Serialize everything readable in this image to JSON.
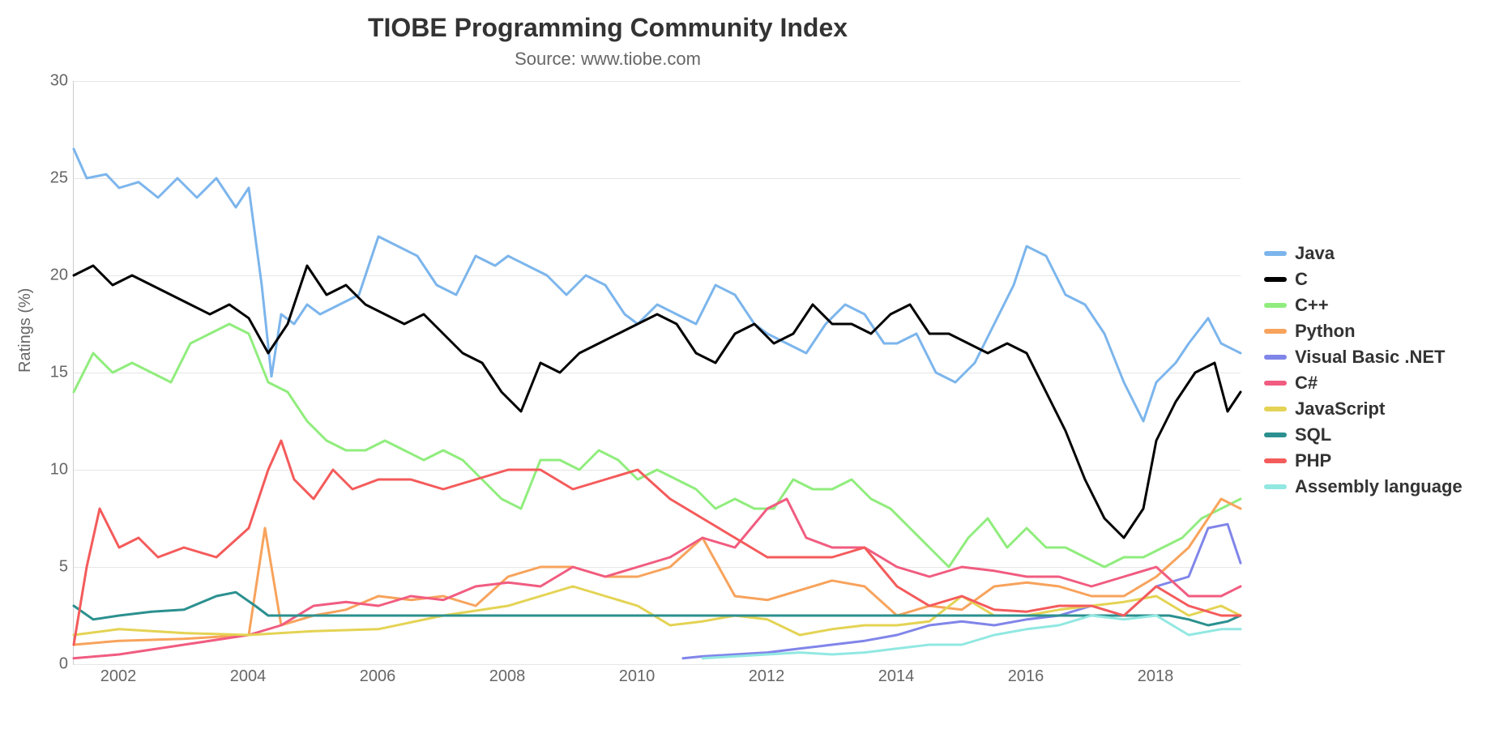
{
  "chart_data": {
    "type": "line",
    "title": "TIOBE Programming Community Index",
    "subtitle": "Source: www.tiobe.com",
    "ylabel": "Ratings (%)",
    "xlabel": "",
    "ylim": [
      0,
      30
    ],
    "xlim": [
      2001.3,
      2019.3
    ],
    "xticks": [
      2002,
      2004,
      2006,
      2008,
      2010,
      2012,
      2014,
      2016,
      2018
    ],
    "yticks": [
      0,
      5,
      10,
      15,
      20,
      25,
      30
    ],
    "grid": true,
    "legend_position": "right",
    "series": [
      {
        "name": "Java",
        "color": "#7cb5ec",
        "x": [
          2001.3,
          2001.5,
          2001.8,
          2002.0,
          2002.3,
          2002.6,
          2002.9,
          2003.2,
          2003.5,
          2003.8,
          2004.0,
          2004.2,
          2004.35,
          2004.5,
          2004.7,
          2004.9,
          2005.1,
          2005.4,
          2005.7,
          2006.0,
          2006.3,
          2006.6,
          2006.9,
          2007.2,
          2007.5,
          2007.8,
          2008.0,
          2008.3,
          2008.6,
          2008.9,
          2009.2,
          2009.5,
          2009.8,
          2010.0,
          2010.3,
          2010.6,
          2010.9,
          2011.2,
          2011.5,
          2011.8,
          2012.0,
          2012.3,
          2012.6,
          2012.9,
          2013.2,
          2013.5,
          2013.8,
          2014.0,
          2014.3,
          2014.6,
          2014.9,
          2015.2,
          2015.5,
          2015.8,
          2016.0,
          2016.3,
          2016.6,
          2016.9,
          2017.2,
          2017.5,
          2017.8,
          2018.0,
          2018.3,
          2018.5,
          2018.8,
          2019.0,
          2019.3
        ],
        "y": [
          26.5,
          25.0,
          25.2,
          24.5,
          24.8,
          24.0,
          25.0,
          24.0,
          25.0,
          23.5,
          24.5,
          19.5,
          14.8,
          18.0,
          17.5,
          18.5,
          18.0,
          18.5,
          19.0,
          22.0,
          21.5,
          21.0,
          19.5,
          19.0,
          21.0,
          20.5,
          21.0,
          20.5,
          20.0,
          19.0,
          20.0,
          19.5,
          18.0,
          17.5,
          18.5,
          18.0,
          17.5,
          19.5,
          19.0,
          17.5,
          17.0,
          16.5,
          16.0,
          17.5,
          18.5,
          18.0,
          16.5,
          16.5,
          17.0,
          15.0,
          14.5,
          15.5,
          17.5,
          19.5,
          21.5,
          21.0,
          19.0,
          18.5,
          17.0,
          14.5,
          12.5,
          14.5,
          15.5,
          16.5,
          17.8,
          16.5,
          16.0
        ]
      },
      {
        "name": "C",
        "color": "#000000",
        "x": [
          2001.3,
          2001.6,
          2001.9,
          2002.2,
          2002.5,
          2002.8,
          2003.1,
          2003.4,
          2003.7,
          2004.0,
          2004.3,
          2004.6,
          2004.9,
          2005.2,
          2005.5,
          2005.8,
          2006.1,
          2006.4,
          2006.7,
          2007.0,
          2007.3,
          2007.6,
          2007.9,
          2008.2,
          2008.5,
          2008.8,
          2009.1,
          2009.4,
          2009.7,
          2010.0,
          2010.3,
          2010.6,
          2010.9,
          2011.2,
          2011.5,
          2011.8,
          2012.1,
          2012.4,
          2012.7,
          2013.0,
          2013.3,
          2013.6,
          2013.9,
          2014.2,
          2014.5,
          2014.8,
          2015.1,
          2015.4,
          2015.7,
          2016.0,
          2016.3,
          2016.6,
          2016.9,
          2017.2,
          2017.5,
          2017.8,
          2018.0,
          2018.3,
          2018.6,
          2018.9,
          2019.1,
          2019.3
        ],
        "y": [
          20.0,
          20.5,
          19.5,
          20.0,
          19.5,
          19.0,
          18.5,
          18.0,
          18.5,
          17.8,
          16.0,
          17.5,
          20.5,
          19.0,
          19.5,
          18.5,
          18.0,
          17.5,
          18.0,
          17.0,
          16.0,
          15.5,
          14.0,
          13.0,
          15.5,
          15.0,
          16.0,
          16.5,
          17.0,
          17.5,
          18.0,
          17.5,
          16.0,
          15.5,
          17.0,
          17.5,
          16.5,
          17.0,
          18.5,
          17.5,
          17.5,
          17.0,
          18.0,
          18.5,
          17.0,
          17.0,
          16.5,
          16.0,
          16.5,
          16.0,
          14.0,
          12.0,
          9.5,
          7.5,
          6.5,
          8.0,
          11.5,
          13.5,
          15.0,
          15.5,
          13.0,
          14.0
        ]
      },
      {
        "name": "C++",
        "color": "#90ed7d",
        "x": [
          2001.3,
          2001.6,
          2001.9,
          2002.2,
          2002.5,
          2002.8,
          2003.1,
          2003.4,
          2003.7,
          2004.0,
          2004.3,
          2004.6,
          2004.9,
          2005.2,
          2005.5,
          2005.8,
          2006.1,
          2006.4,
          2006.7,
          2007.0,
          2007.3,
          2007.6,
          2007.9,
          2008.2,
          2008.5,
          2008.8,
          2009.1,
          2009.4,
          2009.7,
          2010.0,
          2010.3,
          2010.6,
          2010.9,
          2011.2,
          2011.5,
          2011.8,
          2012.1,
          2012.4,
          2012.7,
          2013.0,
          2013.3,
          2013.6,
          2013.9,
          2014.2,
          2014.5,
          2014.8,
          2015.1,
          2015.4,
          2015.7,
          2016.0,
          2016.3,
          2016.6,
          2016.9,
          2017.2,
          2017.5,
          2017.8,
          2018.1,
          2018.4,
          2018.7,
          2019.0,
          2019.3
        ],
        "y": [
          14.0,
          16.0,
          15.0,
          15.5,
          15.0,
          14.5,
          16.5,
          17.0,
          17.5,
          17.0,
          14.5,
          14.0,
          12.5,
          11.5,
          11.0,
          11.0,
          11.5,
          11.0,
          10.5,
          11.0,
          10.5,
          9.5,
          8.5,
          8.0,
          10.5,
          10.5,
          10.0,
          11.0,
          10.5,
          9.5,
          10.0,
          9.5,
          9.0,
          8.0,
          8.5,
          8.0,
          8.0,
          9.5,
          9.0,
          9.0,
          9.5,
          8.5,
          8.0,
          7.0,
          6.0,
          5.0,
          6.5,
          7.5,
          6.0,
          7.0,
          6.0,
          6.0,
          5.5,
          5.0,
          5.5,
          5.5,
          6.0,
          6.5,
          7.5,
          8.0,
          8.5
        ]
      },
      {
        "name": "Python",
        "color": "#f7a35c",
        "x": [
          2001.3,
          2002.0,
          2003.0,
          2004.0,
          2004.25,
          2004.5,
          2005.0,
          2005.5,
          2006.0,
          2006.5,
          2007.0,
          2007.5,
          2008.0,
          2008.5,
          2009.0,
          2009.5,
          2010.0,
          2010.5,
          2011.0,
          2011.5,
          2012.0,
          2012.5,
          2013.0,
          2013.5,
          2014.0,
          2014.5,
          2015.0,
          2015.5,
          2016.0,
          2016.5,
          2017.0,
          2017.5,
          2018.0,
          2018.5,
          2019.0,
          2019.3
        ],
        "y": [
          1.0,
          1.2,
          1.3,
          1.5,
          7.0,
          2.0,
          2.5,
          2.8,
          3.5,
          3.3,
          3.5,
          3.0,
          4.5,
          5.0,
          5.0,
          4.5,
          4.5,
          5.0,
          6.5,
          3.5,
          3.3,
          3.8,
          4.3,
          4.0,
          2.5,
          3.0,
          2.8,
          4.0,
          4.2,
          4.0,
          3.5,
          3.5,
          4.5,
          6.0,
          8.5,
          8.0
        ]
      },
      {
        "name": "Visual Basic .NET",
        "color": "#8085e9",
        "x": [
          2010.7,
          2011.0,
          2011.5,
          2012.0,
          2012.5,
          2013.0,
          2013.5,
          2014.0,
          2014.5,
          2015.0,
          2015.5,
          2016.0,
          2016.5,
          2017.0,
          2017.5,
          2018.0,
          2018.5,
          2018.8,
          2019.1,
          2019.3
        ],
        "y": [
          0.3,
          0.4,
          0.5,
          0.6,
          0.8,
          1.0,
          1.2,
          1.5,
          2.0,
          2.2,
          2.0,
          2.3,
          2.5,
          3.0,
          2.5,
          4.0,
          4.5,
          7.0,
          7.2,
          5.2
        ]
      },
      {
        "name": "C#",
        "color": "#f15c80",
        "x": [
          2001.3,
          2002.0,
          2003.0,
          2004.0,
          2004.5,
          2005.0,
          2005.5,
          2006.0,
          2006.5,
          2007.0,
          2007.5,
          2008.0,
          2008.5,
          2009.0,
          2009.5,
          2010.0,
          2010.5,
          2011.0,
          2011.5,
          2012.0,
          2012.3,
          2012.6,
          2013.0,
          2013.5,
          2014.0,
          2014.5,
          2015.0,
          2015.5,
          2016.0,
          2016.5,
          2017.0,
          2017.5,
          2018.0,
          2018.5,
          2019.0,
          2019.3
        ],
        "y": [
          0.3,
          0.5,
          1.0,
          1.5,
          2.0,
          3.0,
          3.2,
          3.0,
          3.5,
          3.3,
          4.0,
          4.2,
          4.0,
          5.0,
          4.5,
          5.0,
          5.5,
          6.5,
          6.0,
          8.0,
          8.5,
          6.5,
          6.0,
          6.0,
          5.0,
          4.5,
          5.0,
          4.8,
          4.5,
          4.5,
          4.0,
          4.5,
          5.0,
          3.5,
          3.5,
          4.0
        ]
      },
      {
        "name": "JavaScript",
        "color": "#e4d354",
        "x": [
          2001.3,
          2002.0,
          2003.0,
          2004.0,
          2005.0,
          2006.0,
          2007.0,
          2008.0,
          2008.5,
          2009.0,
          2009.5,
          2010.0,
          2010.5,
          2011.0,
          2011.5,
          2012.0,
          2012.5,
          2013.0,
          2013.5,
          2014.0,
          2014.5,
          2015.0,
          2015.5,
          2016.0,
          2016.5,
          2017.0,
          2017.5,
          2018.0,
          2018.5,
          2019.0,
          2019.3
        ],
        "y": [
          1.5,
          1.8,
          1.6,
          1.5,
          1.7,
          1.8,
          2.5,
          3.0,
          3.5,
          4.0,
          3.5,
          3.0,
          2.0,
          2.2,
          2.5,
          2.3,
          1.5,
          1.8,
          2.0,
          2.0,
          2.2,
          3.5,
          2.5,
          2.5,
          2.8,
          3.0,
          3.2,
          3.5,
          2.5,
          3.0,
          2.5
        ]
      },
      {
        "name": "SQL",
        "color": "#2b908f",
        "x": [
          2001.3,
          2001.6,
          2002.0,
          2002.5,
          2003.0,
          2003.5,
          2003.8,
          2004.1,
          2004.3,
          2018.2,
          2018.5,
          2018.8,
          2019.1,
          2019.3
        ],
        "y": [
          3.0,
          2.3,
          2.5,
          2.7,
          2.8,
          3.5,
          3.7,
          3.0,
          2.5,
          2.5,
          2.3,
          2.0,
          2.2,
          2.5
        ]
      },
      {
        "name": "PHP",
        "color": "#f45b5b",
        "x": [
          2001.3,
          2001.5,
          2001.7,
          2002.0,
          2002.3,
          2002.6,
          2003.0,
          2003.5,
          2004.0,
          2004.3,
          2004.5,
          2004.7,
          2005.0,
          2005.3,
          2005.6,
          2006.0,
          2006.5,
          2007.0,
          2007.5,
          2008.0,
          2008.5,
          2009.0,
          2009.5,
          2010.0,
          2010.5,
          2011.0,
          2011.5,
          2012.0,
          2012.5,
          2013.0,
          2013.5,
          2014.0,
          2014.5,
          2015.0,
          2015.5,
          2016.0,
          2016.5,
          2017.0,
          2017.5,
          2018.0,
          2018.5,
          2019.0,
          2019.3
        ],
        "y": [
          1.0,
          5.0,
          8.0,
          6.0,
          6.5,
          5.5,
          6.0,
          5.5,
          7.0,
          10.0,
          11.5,
          9.5,
          8.5,
          10.0,
          9.0,
          9.5,
          9.5,
          9.0,
          9.5,
          10.0,
          10.0,
          9.0,
          9.5,
          10.0,
          8.5,
          7.5,
          6.5,
          5.5,
          5.5,
          5.5,
          6.0,
          4.0,
          3.0,
          3.5,
          2.8,
          2.7,
          3.0,
          3.0,
          2.5,
          4.0,
          3.0,
          2.5,
          2.5
        ]
      },
      {
        "name": "Assembly language",
        "color": "#91e8e1",
        "x": [
          2011.0,
          2011.5,
          2012.0,
          2012.5,
          2013.0,
          2013.5,
          2014.0,
          2014.5,
          2015.0,
          2015.5,
          2016.0,
          2016.5,
          2017.0,
          2017.5,
          2018.0,
          2018.5,
          2019.0,
          2019.3
        ],
        "y": [
          0.3,
          0.4,
          0.5,
          0.6,
          0.5,
          0.6,
          0.8,
          1.0,
          1.0,
          1.5,
          1.8,
          2.0,
          2.5,
          2.3,
          2.5,
          1.5,
          1.8,
          1.8
        ]
      }
    ]
  }
}
